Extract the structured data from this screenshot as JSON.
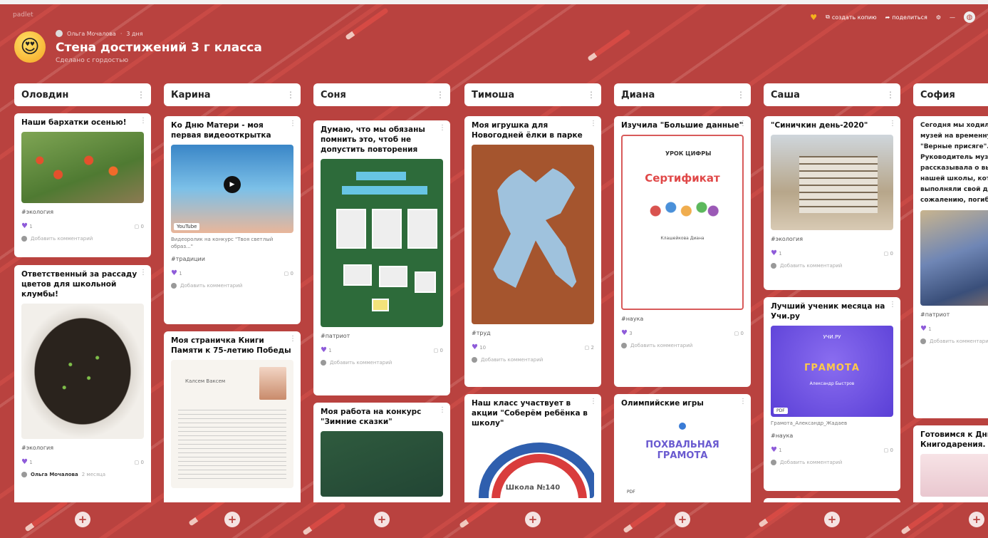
{
  "app": {
    "brand": "padlet"
  },
  "top_actions": {
    "copy": "создать копию",
    "share": "поделиться"
  },
  "wall": {
    "author": "Ольга Мочалова",
    "age": "3 дня",
    "title": "Стена достижений 3 г класса",
    "subtitle": "Сделано с гордостью"
  },
  "columns": [
    {
      "title": "Оловдин"
    },
    {
      "title": "Карина"
    },
    {
      "title": "Соня"
    },
    {
      "title": "Тимоша"
    },
    {
      "title": "Диана"
    },
    {
      "title": "Саша"
    },
    {
      "title": "София"
    }
  ],
  "cards": {
    "c1a": {
      "title": "Наши бархатки осенью!",
      "tag": "#экология",
      "likes": "1",
      "comments": "0",
      "comment_ph": "Добавить комментарий"
    },
    "c1b": {
      "title": "Ответственный за рассаду цветов для школьной клумбы!",
      "tag": "#экология",
      "likes": "1",
      "comments": "0",
      "comment_author": "Ольга Мочалова",
      "comment_age": "2 месяца"
    },
    "c2a": {
      "title": "Ко Дню Матери - моя первая видеооткрытка",
      "video_label": "YouTube",
      "caption": "Видеоролик на конкурс \"Твоя светлый образ...\"",
      "tag": "#традиции",
      "likes": "1",
      "comments": "0",
      "comment_ph": "Добавить комментарий"
    },
    "c2b": {
      "title": "Моя страничка Книги Памяти к 75-летию Победы",
      "doc_title": "Калсем Ваксем"
    },
    "c3a": {
      "title": "Думаю, что мы обязаны помнить это, чтоб не допустить повторения",
      "tag": "#патриот",
      "likes": "1",
      "comments": "0",
      "comment_ph": "Добавить комментарий"
    },
    "c3b": {
      "title": "Моя работа на конкурс \"Зимние сказки\""
    },
    "c4a": {
      "title": "Моя игрушка для Новогодней ёлки в парке",
      "tag": "#труд",
      "likes": "10",
      "comments": "2",
      "comment_ph": "Добавить комментарий"
    },
    "c4b": {
      "title": "Наш класс участвует в акции \"Соберём ребёнка в школу\"",
      "school_text": "Школа №140"
    },
    "c5a": {
      "title": "Изучила \"Большие данные\"",
      "cert_logo": "УРОК ЦИФРЫ",
      "cert_title": "Сертификат",
      "cert_name": "Клашейкова Диана",
      "tag": "#наука",
      "likes": "3",
      "comments": "0",
      "comment_ph": "Добавить комментарий"
    },
    "c5b": {
      "title": "Олимпийские игры",
      "gram_title": "ПОХВАЛЬНАЯ ГРАМОТА",
      "pdf": "PDF"
    },
    "c6a": {
      "title": "\"Синичкин день-2020\"",
      "tag": "#экология",
      "likes": "1",
      "comments": "0",
      "comment_ph": "Добавить комментарий"
    },
    "c6b": {
      "title": "Лучший ученик месяца на Учи.ру",
      "uchi_logo": "УЧИ.РУ",
      "uchi_title": "ГРАМОТА",
      "uchi_name": "Александр Быстров",
      "pdf": "PDF",
      "file": "Грамота_Александр_Жадаев",
      "tag": "#наука",
      "likes": "1",
      "comments": "0",
      "comment_ph": "Добавить комментарий"
    },
    "c7a": {
      "body": "Сегодня мы ходили в школьный музей на временную выставку \"Верные присяге\". Руководитель музея интересно рассказывала о выпускниках нашей школы, которые выполняли свой долг... сожалению, погибли... этом...",
      "tag": "#патриот",
      "likes": "1",
      "comment_ph": "Добавить комментарий"
    },
    "c7b": {
      "title": "Готовимся к Дню Книгодарения."
    }
  },
  "colors": {
    "background": "#b9423f",
    "heart": "#8e5bd9",
    "accent": "#f5b21c"
  },
  "icons": [
    "heart-icon",
    "copy-icon",
    "share-icon",
    "gear-icon",
    "minus-icon",
    "globe-icon",
    "more-vertical-icon",
    "play-icon",
    "plus-icon",
    "comment-icon"
  ]
}
